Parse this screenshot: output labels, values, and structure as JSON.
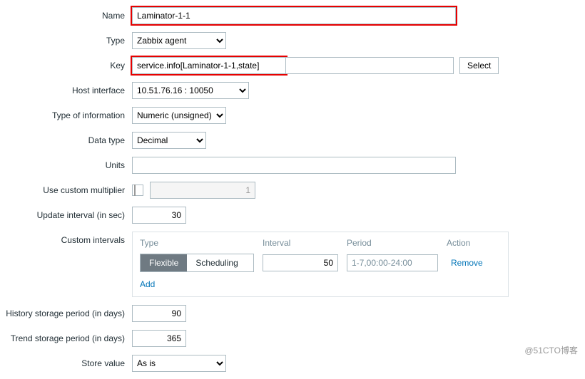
{
  "labels": {
    "name": "Name",
    "type": "Type",
    "key": "Key",
    "host_interface": "Host interface",
    "type_of_info": "Type of information",
    "data_type": "Data type",
    "units": "Units",
    "use_multiplier": "Use custom multiplier",
    "update_interval": "Update interval (in sec)",
    "custom_intervals": "Custom intervals",
    "history_storage": "History storage period (in days)",
    "trend_storage": "Trend storage period (in days)",
    "store_value": "Store value"
  },
  "values": {
    "name": "Laminator-1-1",
    "type": "Zabbix agent",
    "key": "service.info[Laminator-1-1,state]",
    "host_interface": "10.51.76.16 : 10050",
    "type_of_info": "Numeric (unsigned)",
    "data_type": "Decimal",
    "units": "",
    "multiplier": "1",
    "update_interval": "30",
    "history_storage": "90",
    "trend_storage": "365",
    "store_value": "As is"
  },
  "buttons": {
    "select": "Select"
  },
  "intervals": {
    "headers": {
      "type": "Type",
      "interval": "Interval",
      "period": "Period",
      "action": "Action"
    },
    "toggle": {
      "flexible": "Flexible",
      "scheduling": "Scheduling"
    },
    "row": {
      "interval": "50",
      "period": "1-7,00:00-24:00"
    },
    "remove": "Remove",
    "add": "Add"
  },
  "watermark": "@51CTO博客"
}
